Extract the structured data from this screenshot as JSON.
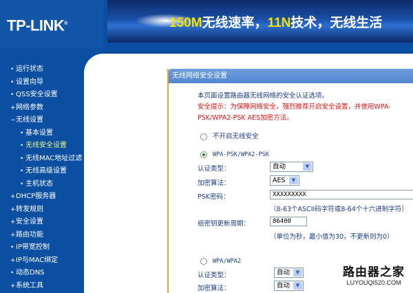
{
  "header": {
    "logo": "TP-LINK",
    "banner": {
      "part1": "150M",
      "part2": "无线速率，",
      "part3": "11N",
      "part4": "技术，无线生活"
    }
  },
  "sidebar": {
    "items": [
      {
        "label": "运行状态",
        "bullet": "•",
        "level": 0
      },
      {
        "label": "设置向导",
        "bullet": "•",
        "level": 0
      },
      {
        "label": "QSS安全设置",
        "bullet": "•",
        "level": 0
      },
      {
        "label": "网络参数",
        "bullet": "+",
        "level": 0
      },
      {
        "label": "无线设置",
        "bullet": "−",
        "level": 0
      },
      {
        "label": "基本设置",
        "bullet": "•",
        "level": 1
      },
      {
        "label": "无线安全设置",
        "bullet": "•",
        "level": 1,
        "selected": true
      },
      {
        "label": "无线MAC地址过滤",
        "bullet": "•",
        "level": 1
      },
      {
        "label": "无线高级设置",
        "bullet": "•",
        "level": 1
      },
      {
        "label": "主机状态",
        "bullet": "•",
        "level": 1
      },
      {
        "label": "DHCP服务器",
        "bullet": "+",
        "level": 0
      },
      {
        "label": "转发规则",
        "bullet": "+",
        "level": 0
      },
      {
        "label": "安全设置",
        "bullet": "+",
        "level": 0
      },
      {
        "label": "路由功能",
        "bullet": "+",
        "level": 0
      },
      {
        "label": "IP带宽控制",
        "bullet": "•",
        "level": 0
      },
      {
        "label": "IP与MAC绑定",
        "bullet": "+",
        "level": 0
      },
      {
        "label": "动态DNS",
        "bullet": "•",
        "level": 0
      },
      {
        "label": "系统工具",
        "bullet": "+",
        "level": 0
      }
    ]
  },
  "panel": {
    "title": "无线网络安全设置",
    "intro": "本页面设置路由器无线网络的安全认证选项。",
    "warning_line1": "安全提示：为保障网络安全，强烈推荐开启安全设置，并使用WPA-",
    "warning_line2": "PSK/WPA2-PSK AES加密方法。",
    "option_none": "不开启无线安全",
    "option_psk": "WPA-PSK/WPA2-PSK",
    "psk": {
      "auth_label": "认证类型：",
      "auth_value": "自动",
      "enc_label": "加密算法：",
      "enc_value": "AES",
      "pwd_label": "PSK密码：",
      "pwd_value": "XXXXXXXXX",
      "pwd_hint": "（8-63个ASCII码字符或8-64个十六进制字符）",
      "period_label": "组密钥更新周期：",
      "period_value": "86400",
      "period_hint": "（单位为秒，最小值为30，不更新则为0）"
    },
    "option_wpa": "WPA/WPA2",
    "wpa": {
      "auth_label": "认证类型：",
      "auth_value": "自动",
      "enc_label": "加密算法：",
      "enc_value": "自动"
    }
  },
  "watermark": {
    "cn": "路由器之家",
    "en": "LUYOUQI520.COM"
  }
}
